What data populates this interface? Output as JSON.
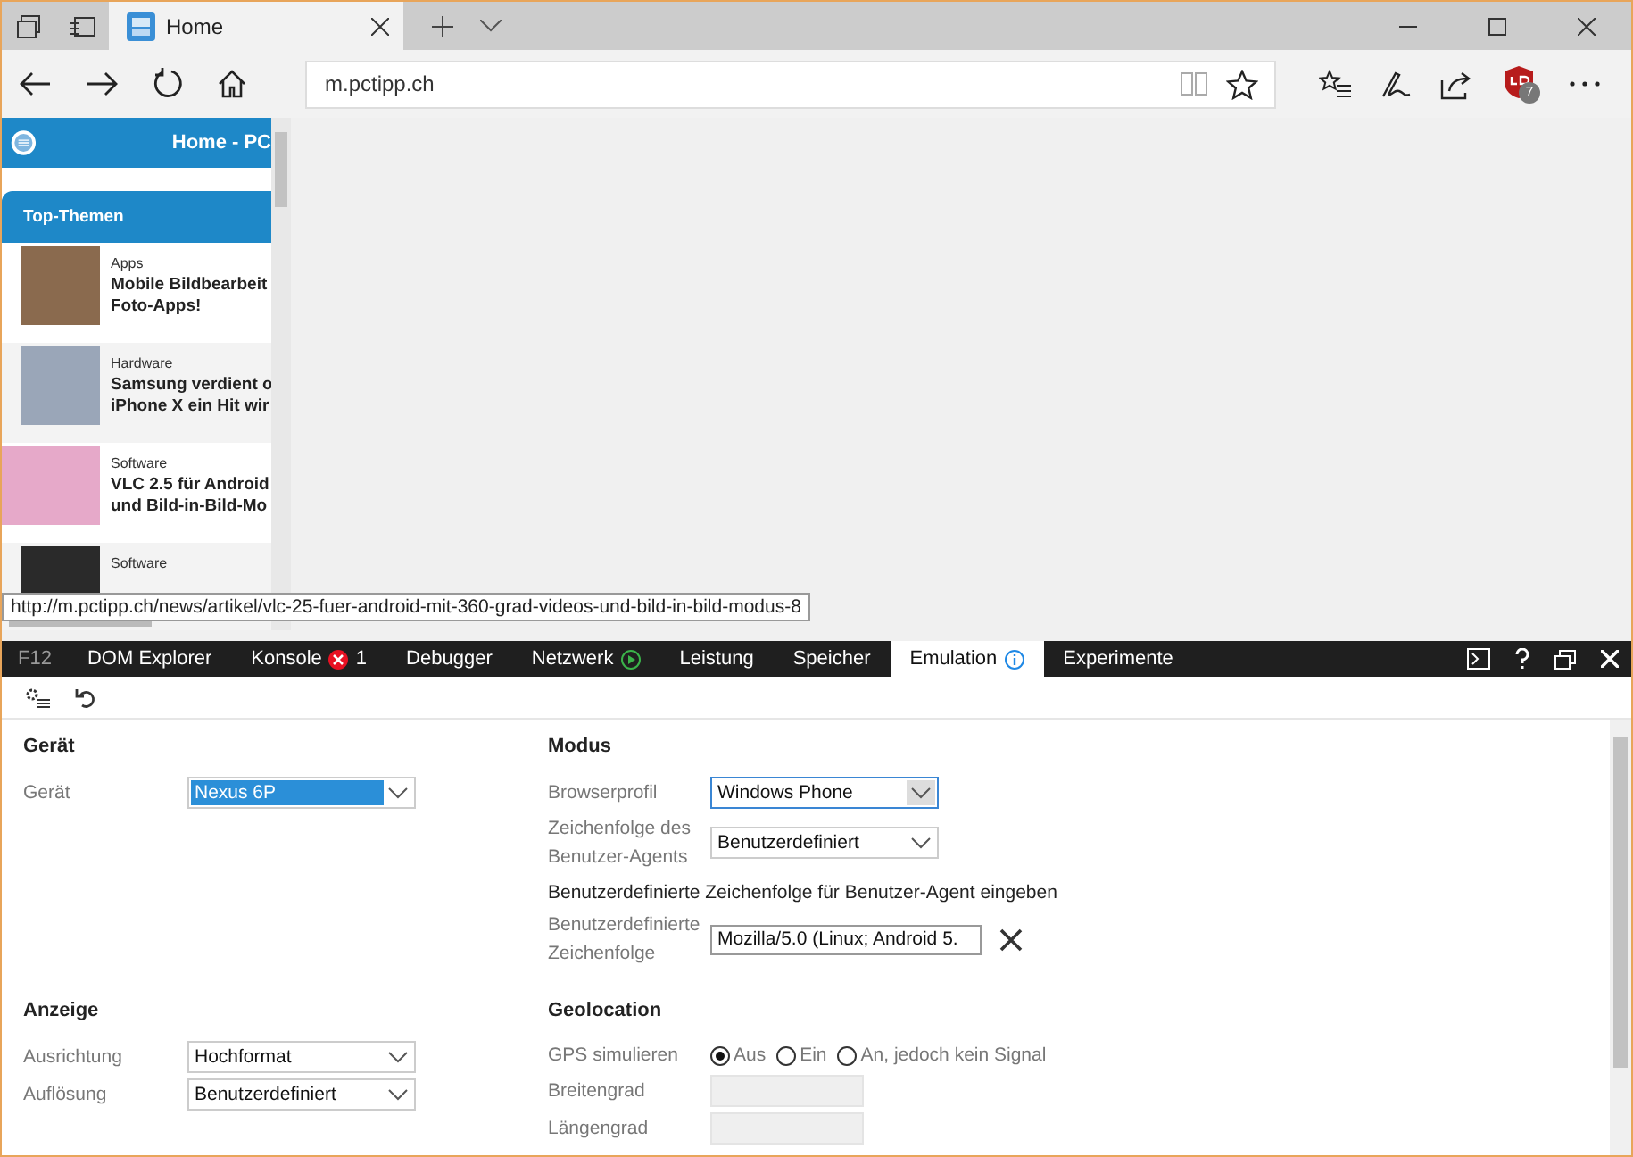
{
  "browser": {
    "tab_title": "Home",
    "address": "m.pctipp.ch",
    "extension_badge": "7"
  },
  "page": {
    "header_title": "Home - PC",
    "section_title": "Top-Themen",
    "articles": [
      {
        "category": "Apps",
        "title_lines": [
          "Mobile Bildbearbeit",
          "Foto-Apps!"
        ]
      },
      {
        "category": "Hardware",
        "title_lines": [
          "Samsung verdient o",
          "iPhone X ein Hit wir"
        ]
      },
      {
        "category": "Software",
        "title_lines": [
          "VLC 2.5 für Android",
          "und Bild-in-Bild-Mo"
        ]
      },
      {
        "category": "Software"
      }
    ]
  },
  "status_url": "http://m.pctipp.ch/news/artikel/vlc-25-fuer-android-mit-360-grad-videos-und-bild-in-bild-modus-8",
  "devtools": {
    "f12_label": "F12",
    "tabs": [
      {
        "label": "DOM Explorer",
        "kind": "plain",
        "selected": false
      },
      {
        "label": "Konsole",
        "kind": "error",
        "count": "1",
        "selected": false
      },
      {
        "label": "Debugger",
        "kind": "plain",
        "selected": false
      },
      {
        "label": "Netzwerk",
        "kind": "play",
        "selected": false
      },
      {
        "label": "Leistung",
        "kind": "plain",
        "selected": false
      },
      {
        "label": "Speicher",
        "kind": "plain",
        "selected": false
      },
      {
        "label": "Emulation",
        "kind": "info",
        "selected": true
      },
      {
        "label": "Experimente",
        "kind": "plain",
        "selected": false
      }
    ],
    "sections": [
      {
        "title": "Gerät",
        "rows": [
          {
            "kind": "select",
            "label": "Gerät",
            "value": "Nexus 6P",
            "highlighted": true,
            "focused": false
          }
        ]
      },
      {
        "title": "Modus",
        "rows": [
          {
            "kind": "select",
            "label": "Browserprofil",
            "value": "Windows Phone",
            "highlighted": false,
            "focused": true
          },
          {
            "kind": "select",
            "label": "Zeichenfolge des Benutzer-Agents",
            "value": "Benutzerdefiniert",
            "highlighted": false,
            "focused": false
          },
          {
            "kind": "note",
            "label": "Benutzerdefinierte Zeichenfolge für Benutzer-Agent eingeben"
          },
          {
            "kind": "text",
            "label": "Benutzerdefinierte Zeichenfolge",
            "value": "Mozilla/5.0 (Linux; Android 5."
          }
        ]
      },
      {
        "title": "Anzeige",
        "rows": [
          {
            "kind": "select",
            "label": "Ausrichtung",
            "value": "Hochformat",
            "highlighted": false,
            "focused": false
          },
          {
            "kind": "select",
            "label": "Auflösung",
            "value": "Benutzerdefiniert",
            "highlighted": false,
            "focused": false
          }
        ]
      },
      {
        "title": "Geolocation",
        "rows": [
          {
            "kind": "radio",
            "label": "GPS simulieren",
            "options": [
              {
                "label": "Aus",
                "selected": true
              },
              {
                "label": "Ein",
                "selected": false
              },
              {
                "label": "An, jedoch kein Signal",
                "selected": false
              }
            ]
          },
          {
            "kind": "disabled",
            "label": "Breitengrad"
          },
          {
            "kind": "disabled",
            "label": "Längengrad"
          }
        ]
      }
    ]
  }
}
